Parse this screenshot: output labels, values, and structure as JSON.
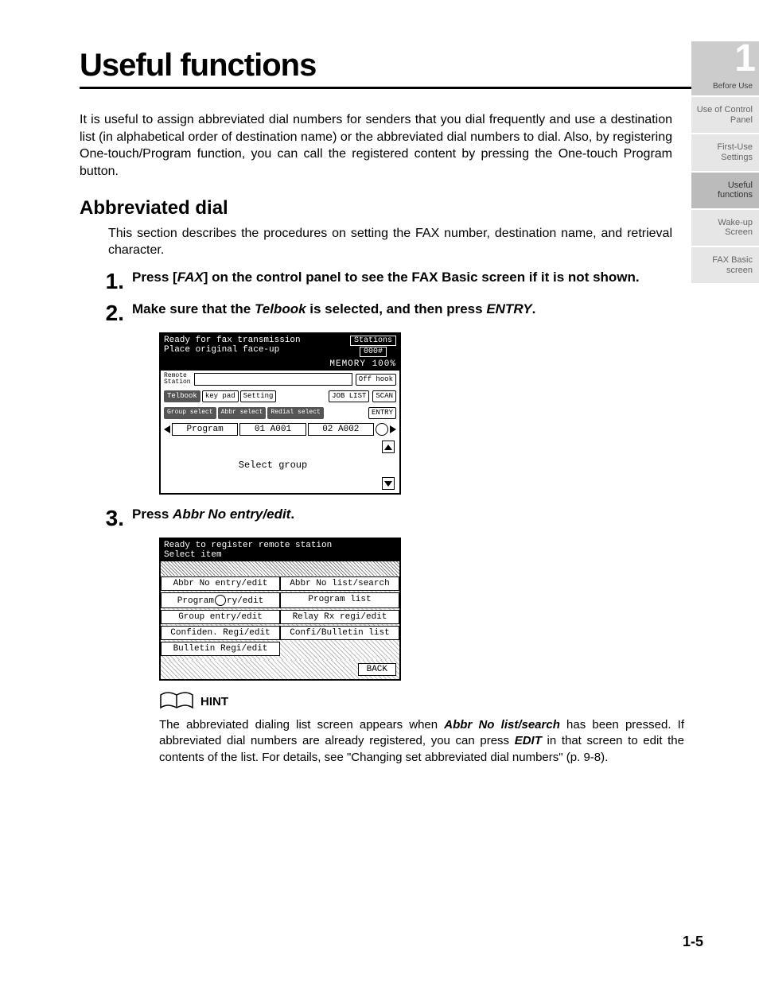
{
  "title": "Useful functions",
  "intro": "It is useful to assign abbreviated dial numbers for senders that you dial frequently and use a destination list (in alphabetical order of destination name) or the abbreviated dial numbers to dial. Also, by registering One-touch/Program function, you can call the registered content by pressing the One-touch Program button.",
  "subsection": "Abbreviated dial",
  "desc": "This section describes the procedures on setting the FAX number, destination name, and retrieval character.",
  "steps": {
    "s1": {
      "pre": "Press [",
      "ital": "FAX",
      "post": "] on the control panel to see the FAX Basic screen if it is not shown."
    },
    "s2": {
      "a": "Make sure that the ",
      "b": "Telbook",
      "c": " is selected, and then press ",
      "d": "ENTRY",
      "e": "."
    },
    "s3": {
      "a": "Press ",
      "b": "Abbr No entry/edit",
      "c": "."
    }
  },
  "lcd1": {
    "line1": "Ready for fax transmission",
    "line2": "Place original face-up",
    "stations_lbl": "Stations",
    "stations_val": "000#",
    "memory": "MEMORY 100%",
    "remote": "Remote\nStation",
    "offhook": "Off hook",
    "telbook": "Telbook",
    "keypad": "key pad",
    "setting": "Setting",
    "joblist": "JOB LIST",
    "scan": "SCAN",
    "group_sel": "Group select",
    "abbr_sel": "Abbr select",
    "redial_sel": "Redial select",
    "entry": "ENTRY",
    "program": "Program",
    "p1": "01 A001",
    "p2": "02 A002",
    "select_group": "Select group"
  },
  "lcd2": {
    "line1": "Ready to register remote station",
    "line2": "Select item",
    "cells": {
      "c1": "Abbr No entry/edit",
      "c2": "Abbr No list/search",
      "c3a": "Program",
      "c3b": "ry/edit",
      "c4": "Program list",
      "c5": "Group entry/edit",
      "c6": "Relay Rx regi/edit",
      "c7": "Confiden. Regi/edit",
      "c8": "Confi/Bulletin list",
      "c9": "Bulletin Regi/edit"
    },
    "back": "BACK"
  },
  "hint_label": "HINT",
  "hint": {
    "a": "The abbreviated dialing list screen appears when ",
    "b": "Abbr No list/search",
    "c": " has been pressed. If abbreviated dial numbers are already registered, you can press ",
    "d": "EDIT",
    "e": " in that screen to edit the contents of the list. For details, see \"Changing set abbreviated dial numbers\" (p. 9-8)."
  },
  "tabs": {
    "num": "1",
    "t1": "Before Use",
    "t2": "Use of Control Panel",
    "t3": "First-Use Settings",
    "t4": "Useful functions",
    "t5": "Wake-up Screen",
    "t6": "FAX Basic screen"
  },
  "page_num": "1-5"
}
